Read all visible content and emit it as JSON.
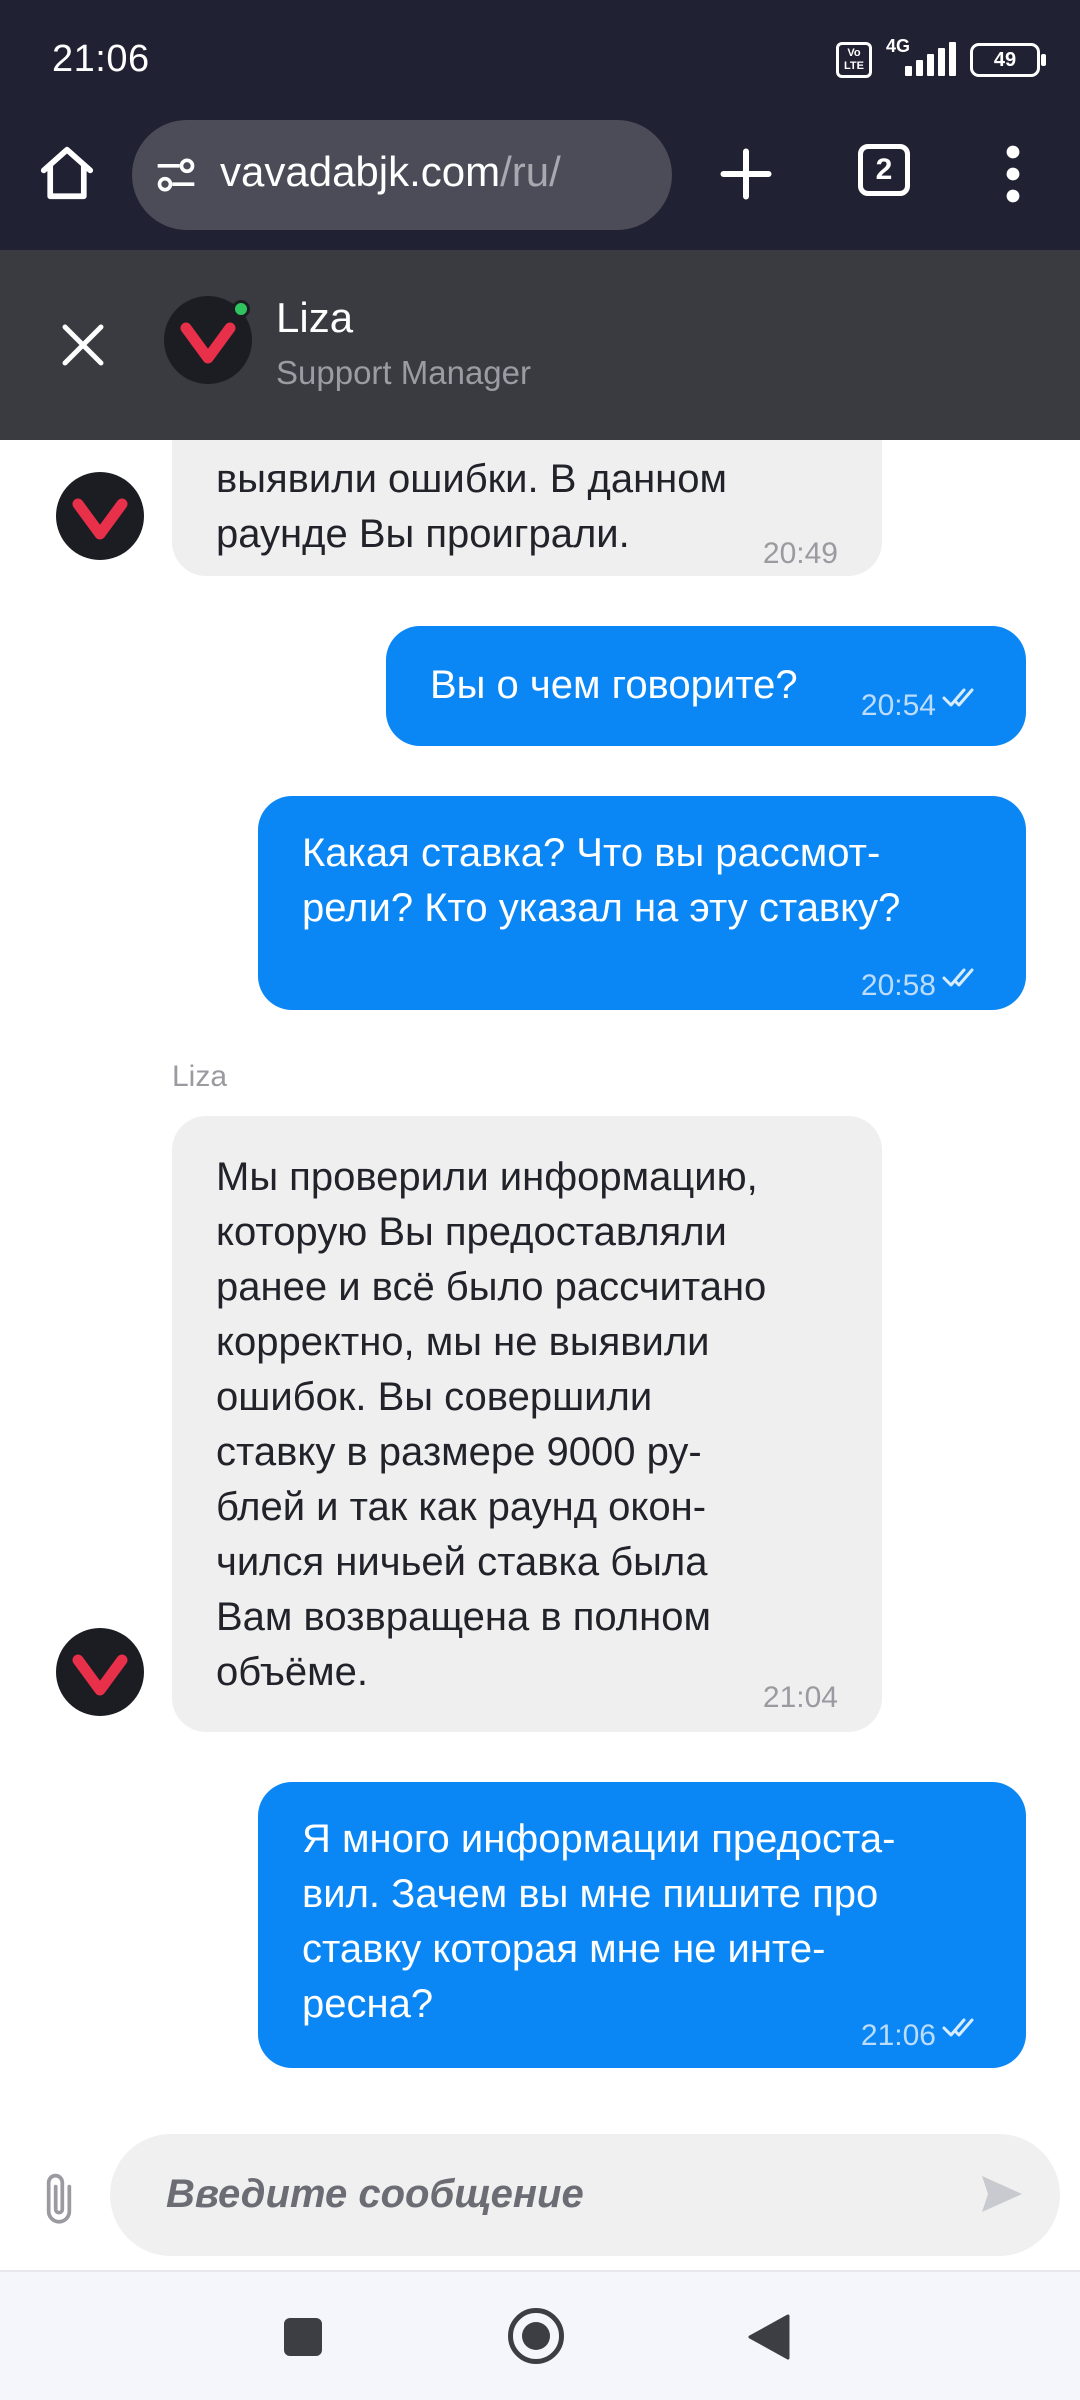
{
  "status_bar": {
    "time": "21:06",
    "volte": "Vo LTE",
    "network": "4G",
    "battery": "49"
  },
  "browser": {
    "url_domain": "vavadabjk.com",
    "url_path": "/ru/",
    "tab_count": "2",
    "icons": [
      "home-icon",
      "site-settings-icon",
      "plus-icon",
      "tabs-icon",
      "more-vert-icon"
    ]
  },
  "chat_header": {
    "agent_name": "Liza",
    "agent_role": "Support Manager",
    "icons": [
      "close-icon",
      "vavada-logo-icon"
    ]
  },
  "messages": [
    {
      "id": "m1",
      "direction": "in",
      "text": "выявили ошибки. В данном\nраунде Вы проиграли.",
      "time": "20:49"
    },
    {
      "id": "m2",
      "direction": "out",
      "text": "Вы о чем говорите?",
      "time": "20:54"
    },
    {
      "id": "m3",
      "direction": "out",
      "text": "Какая ставка? Что вы рассмот-\nрели? Кто указал на эту ставку?",
      "time": "20:58"
    },
    {
      "id": "m4",
      "direction": "in",
      "sender": "Liza",
      "text": "Мы проверили информацию,\nкоторую Вы предоставляли\nранее и всё было рассчитано\nкорректно, мы не выявили\nошибок. Вы совершили\nставку в размере 9000 ру-\nблей и так как раунд окон-\nчился ничьей ставка была\nВам возвращена в полном\nобъёме.",
      "time": "21:04"
    },
    {
      "id": "m5",
      "direction": "out",
      "text": "Я много информации предоста-\nвил. Зачем вы мне пишите про\nставку которая мне не инте-\nресна?",
      "time": "21:06"
    }
  ],
  "composer": {
    "placeholder": "Введите сообщение"
  },
  "colors": {
    "dark_bar": "#202233",
    "chat_header": "#3a3b40",
    "outgoing_bubble": "#0a86f5",
    "incoming_bubble": "#efefef",
    "brand_red": "#e8304a",
    "online": "#2fc45f"
  }
}
